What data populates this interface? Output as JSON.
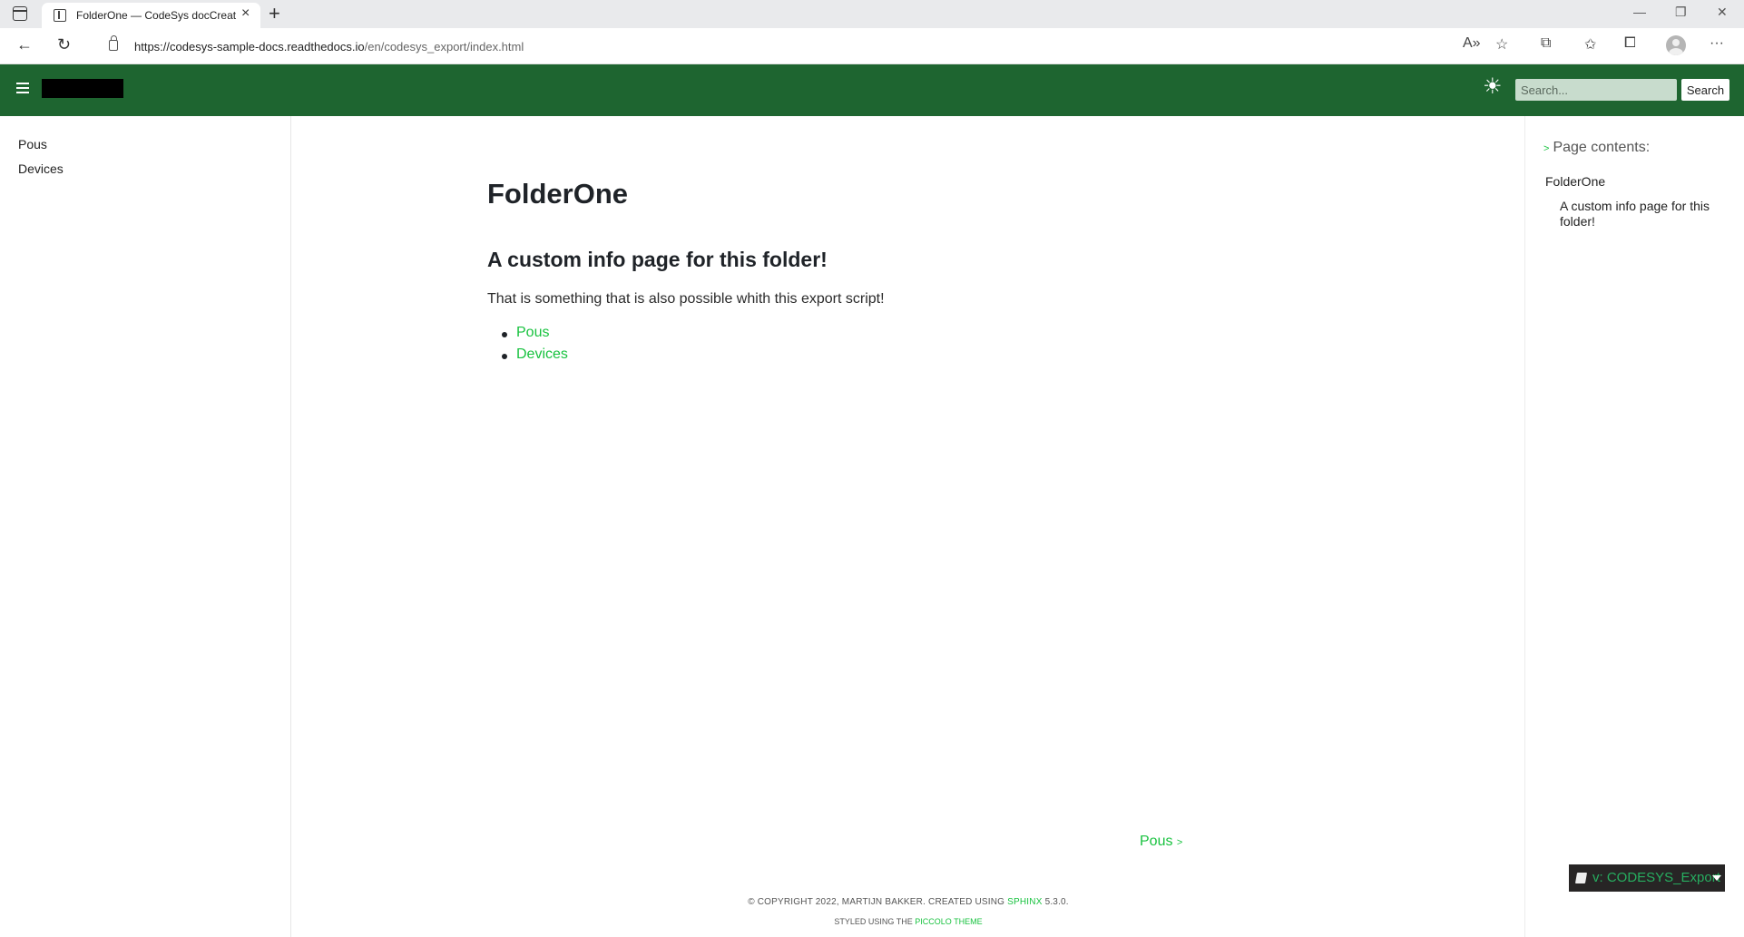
{
  "browser": {
    "tab_title": "FolderOne — CodeSys docCreat",
    "url_domain": "https://codesys-sample-docs.readthedocs.io",
    "url_path": "/en/codesys_export/index.html"
  },
  "header": {
    "search_placeholder": "Search...",
    "search_button": "Search"
  },
  "sidebar": {
    "items": [
      {
        "label": "Pous"
      },
      {
        "label": "Devices"
      }
    ]
  },
  "main": {
    "title": "FolderOne",
    "section_title": "A custom info page for this folder!",
    "paragraph": "That is something that is also possible whith this export script!",
    "links": [
      {
        "label": "Pous"
      },
      {
        "label": "Devices"
      }
    ],
    "next_link": "Pous",
    "next_arrow": ">"
  },
  "footer": {
    "copyright_pre": "© Copyright 2022, Martijn Bakker. Created using",
    "sphinx": "Sphinx",
    "version": "5.3.0.",
    "styled_pre": "Styled using the",
    "theme": "Piccolo Theme"
  },
  "toc": {
    "title": "Page contents:",
    "items": [
      {
        "label": "FolderOne"
      },
      {
        "label": "A custom info page for this folder!"
      }
    ]
  },
  "version_badge": "v: CODESYS_Export",
  "colors": {
    "header_bg": "#1e6530",
    "link": "#18c23f"
  }
}
